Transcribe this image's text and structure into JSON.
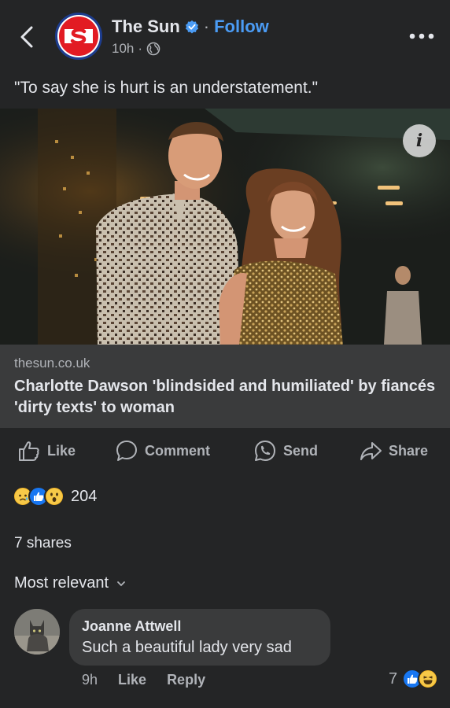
{
  "post": {
    "page_name": "The Sun",
    "follow_label": "Follow",
    "separator": "·",
    "time": "10h",
    "meta_separator": "·",
    "caption": "\"To say she is hurt is an understatement.\""
  },
  "link_preview": {
    "domain": "thesun.co.uk",
    "headline": "Charlotte Dawson 'blindsided and humiliated' by fiancés 'dirty texts' to woman",
    "info_label": "i"
  },
  "actions": {
    "like": "Like",
    "comment": "Comment",
    "send": "Send",
    "share": "Share"
  },
  "stats": {
    "reaction_count": "204",
    "shares": "7 shares"
  },
  "comments": {
    "sort_label": "Most relevant",
    "items": [
      {
        "author": "Joanne Attwell",
        "text": "Such a beautiful lady very sad",
        "time": "9h",
        "like": "Like",
        "reply": "Reply",
        "reaction_count": "7"
      }
    ]
  },
  "colors": {
    "background": "#242526",
    "surface": "#3a3b3c",
    "accent": "#4b9cf5",
    "text_primary": "#e4e6eb",
    "text_secondary": "#b0b3b8",
    "brand_red": "#e21b23"
  },
  "icons": [
    "back-icon",
    "verified-icon",
    "globe-icon",
    "more-icon",
    "info-icon",
    "like-icon",
    "comment-icon",
    "send-icon",
    "share-icon",
    "sad-reaction-icon",
    "like-reaction-icon",
    "wow-reaction-icon",
    "haha-reaction-icon",
    "chevron-down-icon"
  ]
}
